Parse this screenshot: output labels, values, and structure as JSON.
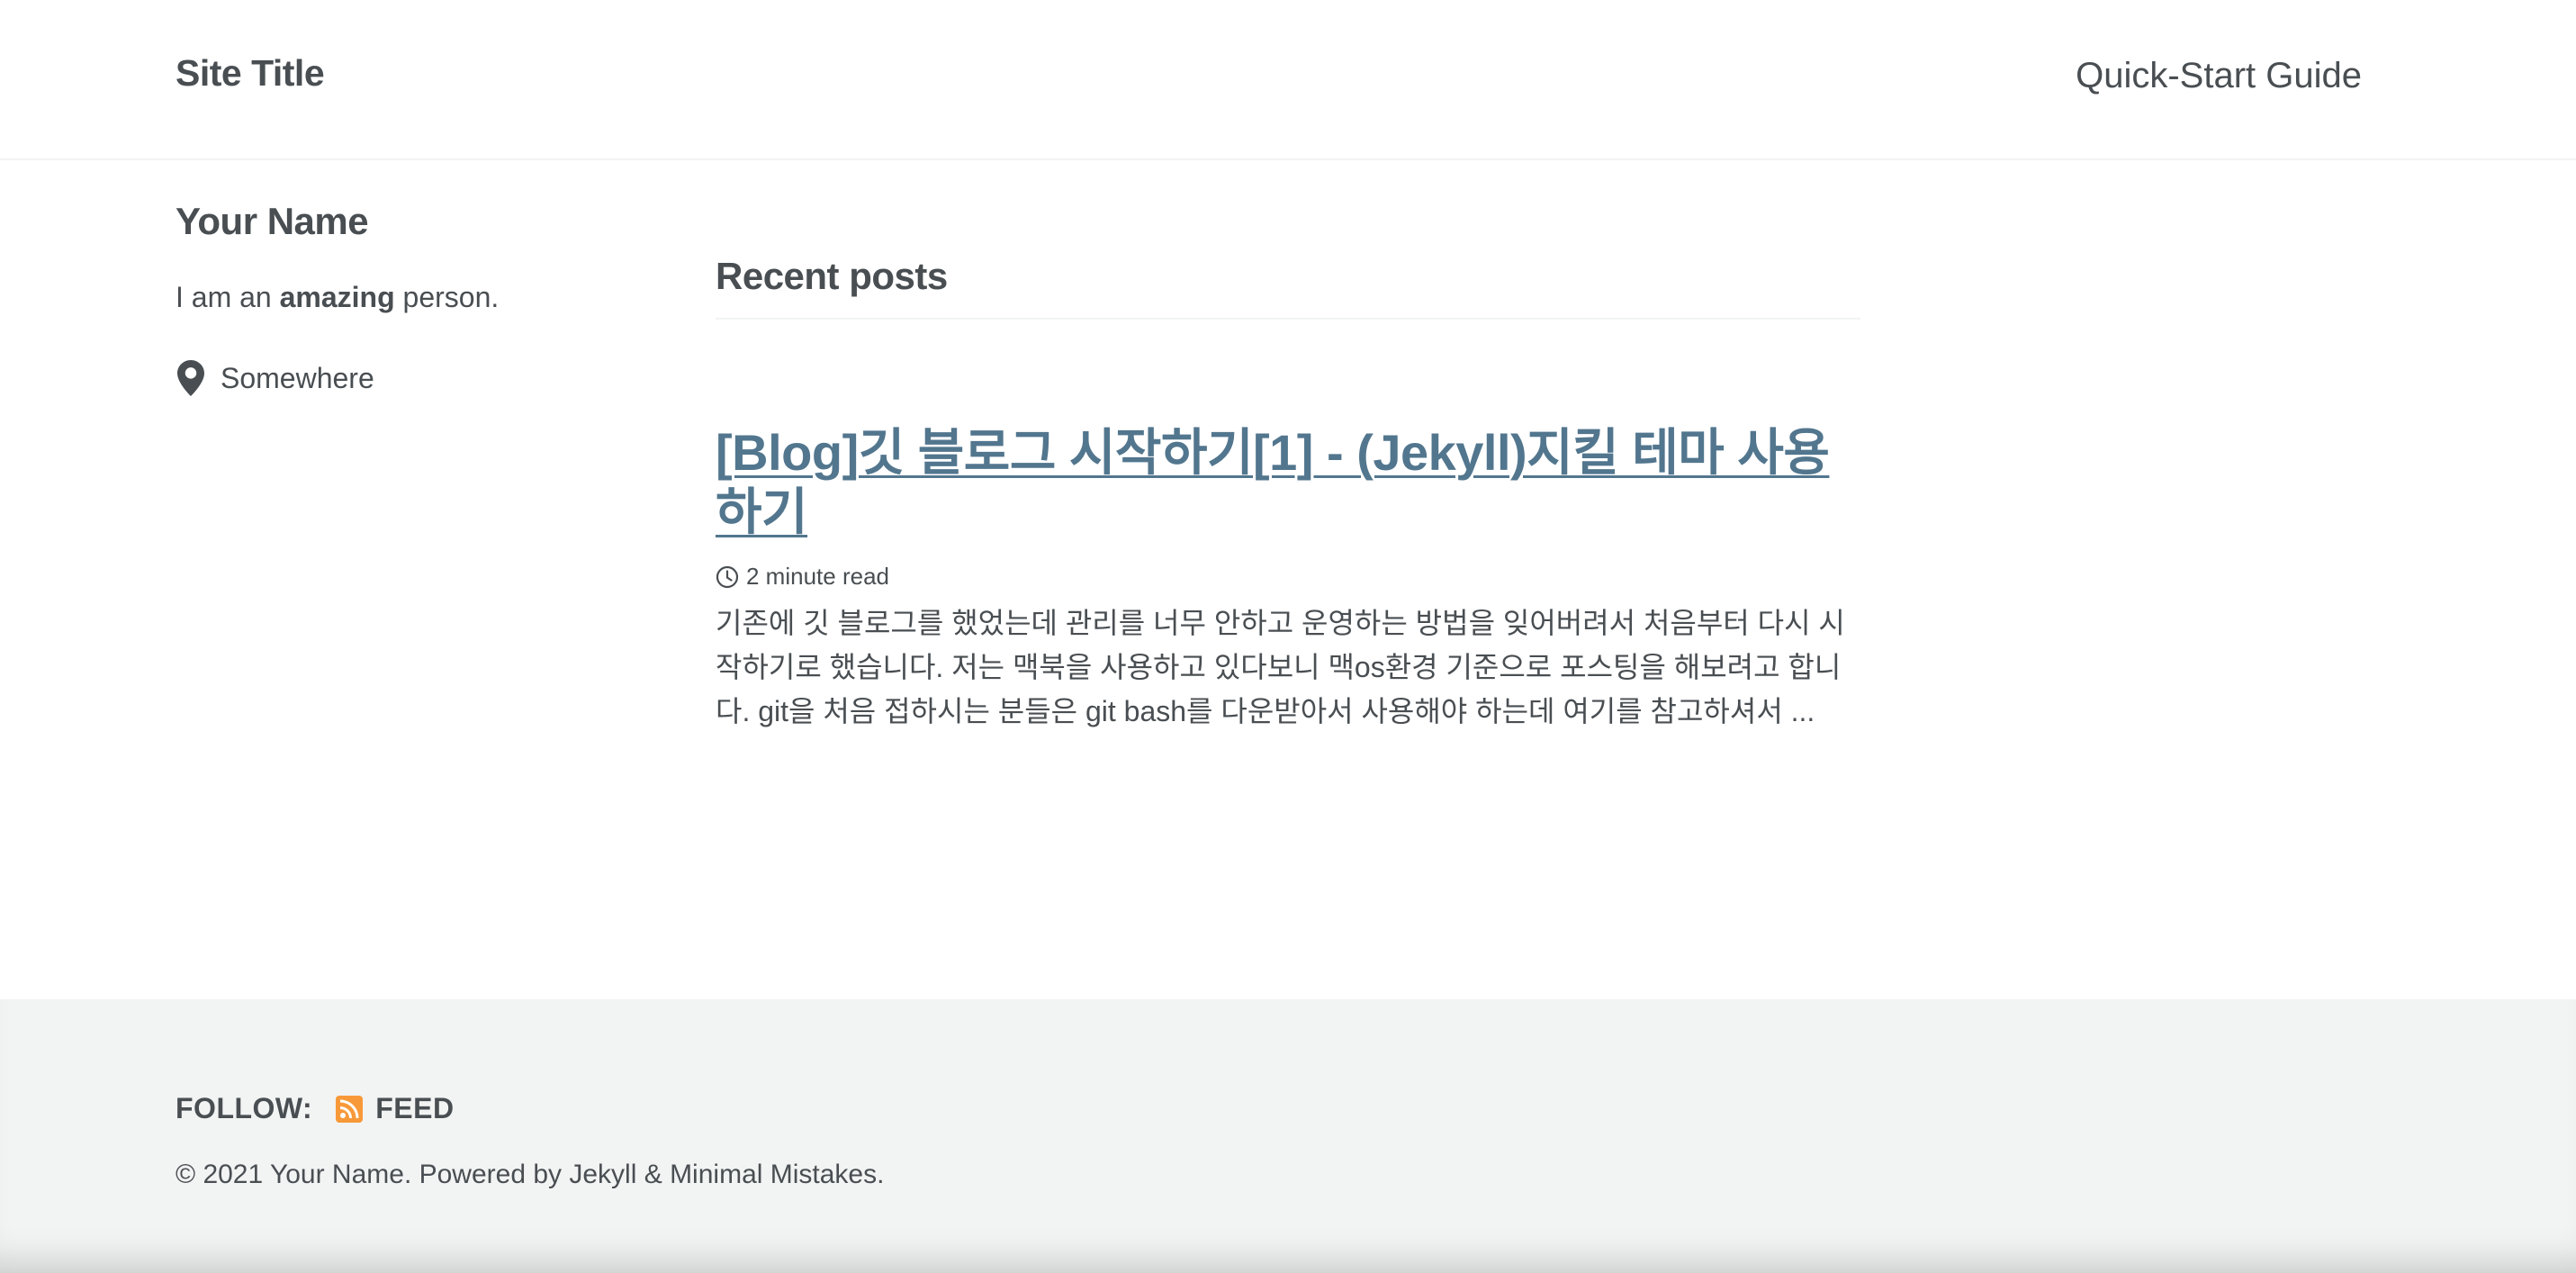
{
  "header": {
    "site_title": "Site Title",
    "nav": [
      {
        "label": "Quick-Start Guide"
      }
    ]
  },
  "sidebar": {
    "author_name": "Your Name",
    "bio_prefix": "I am an ",
    "bio_emphasis": "amazing",
    "bio_suffix": " person.",
    "location": "Somewhere",
    "location_icon": "map-marker-icon"
  },
  "main": {
    "section_heading": "Recent posts",
    "posts": [
      {
        "title": "[Blog]깃 블로그 시작하기[1] - (Jekyll)지킬 테마 사용하기",
        "read_time": "2 minute read",
        "read_time_icon": "clock-icon",
        "excerpt": "기존에 깃 블로그를 했었는데 관리를 너무 안하고 운영하는 방법을 잊어버려서 처음부터 다시 시작하기로 했습니다. 저는 맥북을 사용하고 있다보니 맥os환경 기준으로 포스팅을 해보려고 합니다. git을 처음 접하시는 분들은 git bash를 다운받아서 사용해야 하는데 여기를 참고하셔서 ..."
      }
    ]
  },
  "footer": {
    "follow_label": "FOLLOW:",
    "feed_label": "FEED",
    "feed_icon": "rss-icon",
    "copyright": "© 2021 Your Name. Powered by Jekyll & Minimal Mistakes."
  },
  "colors": {
    "text": "#494e52",
    "link": "#52768e",
    "footer_bg": "#f2f3f3",
    "rss": "#f89939"
  }
}
